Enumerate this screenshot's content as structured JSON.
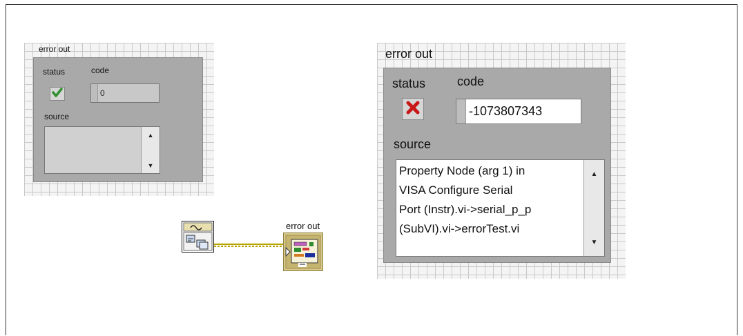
{
  "left_panel": {
    "title": "error out",
    "status_label": "status",
    "code_label": "code",
    "code_value": "0",
    "source_label": "source",
    "source_value": "",
    "status_ok": true
  },
  "right_panel": {
    "title": "error out",
    "status_label": "status",
    "code_label": "code",
    "code_value": "-1073807343",
    "source_label": "source",
    "source_lines": [
      "Property Node (arg 1) in",
      "VISA Configure Serial",
      "Port (Instr).vi->serial_p_p",
      "(SubVI).vi->errorTest.vi"
    ],
    "status_ok": false
  },
  "block_diagram": {
    "terminal_label": "error out",
    "source_icon": "vi-subvi-icon",
    "terminal_icon": "error-cluster-indicator-icon",
    "wire_color": "#b8a200"
  },
  "colors": {
    "ok_green": "#2f8f2f",
    "error_red": "#c81818",
    "cluster_gray": "#a9a9a9"
  }
}
